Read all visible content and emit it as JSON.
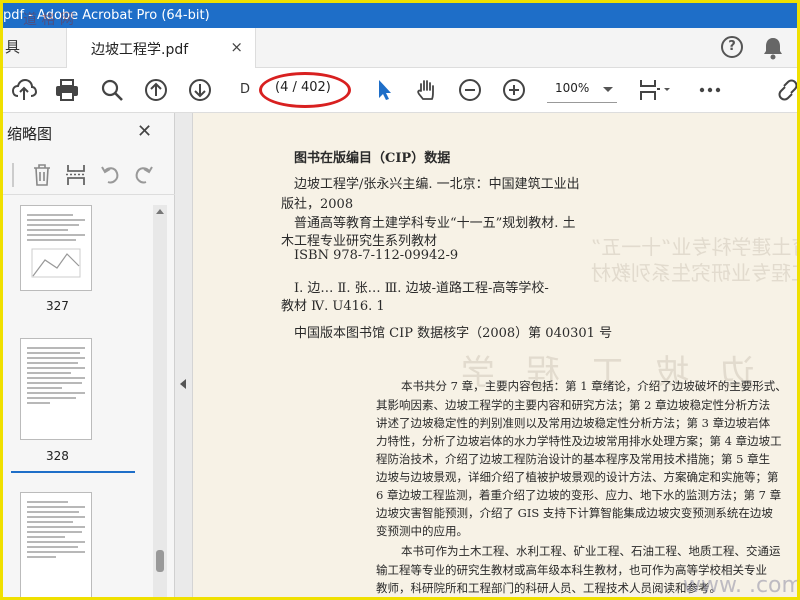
{
  "app": {
    "title": "pdf - Adobe Acrobat Pro (64-bit)",
    "watermark_logo": "道 格 网"
  },
  "tabs": {
    "tools_label": "具",
    "document_tab": "边坡工程学.pdf",
    "close_glyph": "×"
  },
  "toolbar": {
    "page_input": "D",
    "page_count": "(4 / 402)",
    "zoom": "100%",
    "accent_color": "#1e6ec8",
    "highlight_color": "#d82020"
  },
  "thumbnails": {
    "title": "缩略图",
    "close_glyph": "✕",
    "pages": [
      {
        "number": "327"
      },
      {
        "number": "328",
        "selected": true
      },
      {
        "number": ""
      }
    ]
  },
  "document": {
    "cip_heading": "图书在版编目（CIP）数据",
    "cip_lines": [
      "边坡工程学/张永兴主编. 一北京：中国建筑工业出",
      "版社，2008",
      "普通高等教育土建学科专业“十一五”规划教材. 土",
      "木工程专业研究生系列教材",
      "ISBN 978-7-112-09942-9",
      "Ⅰ. 边… Ⅱ. 张… Ⅲ. 边坡-道路工程-高等学校-",
      "教材 Ⅳ. U416. 1",
      "中国版本图书馆 CIP 数据核字（2008）第 040301 号"
    ],
    "body_lines": [
      "本书共分 7 章，主要内容包括：第 1 章绪论，介绍了边坡破坏的主要形式、",
      "其影响因素、边坡工程学的主要内容和研究方法；第 2 章边坡稳定性分析方法",
      "讲述了边坡稳定性的判别准则以及常用边坡稳定性分析方法；第 3 章边坡岩体",
      "力特性，分析了边坡岩体的水力学特性及边坡常用排水处理方案；第 4 章边坡工",
      "程防治技术，介绍了边坡工程防治设计的基本程序及常用技术措施；第 5 章生",
      "边坡与边坡景观，详细介绍了植被护坡景观的设计方法、方案确定和实施等；第",
      "6 章边坡工程监测，着重介绍了边坡的变形、应力、地下水的监测方法；第 7 章",
      "边坡灾害智能预测，介绍了 GIS 支持下计算智能集成边坡灾变预测系统在边坡",
      "变预测中的应用。",
      "本书可作为土木工程、水利工程、矿业工程、石油工程、地质工程、交通运",
      "输工程等专业的研究生教材或高年级本科生教材，也可作为高等学校相关专业",
      "教师，科研院所和工程部门的科研人员、工程技术人员阅读和参考。"
    ],
    "ghost_lines": [
      "普通高等教育土建学科专业“十一五”",
      "土木工程专业研究生系列教材",
      "边 坡 工 程 学"
    ],
    "watermark": "www.      .com"
  }
}
